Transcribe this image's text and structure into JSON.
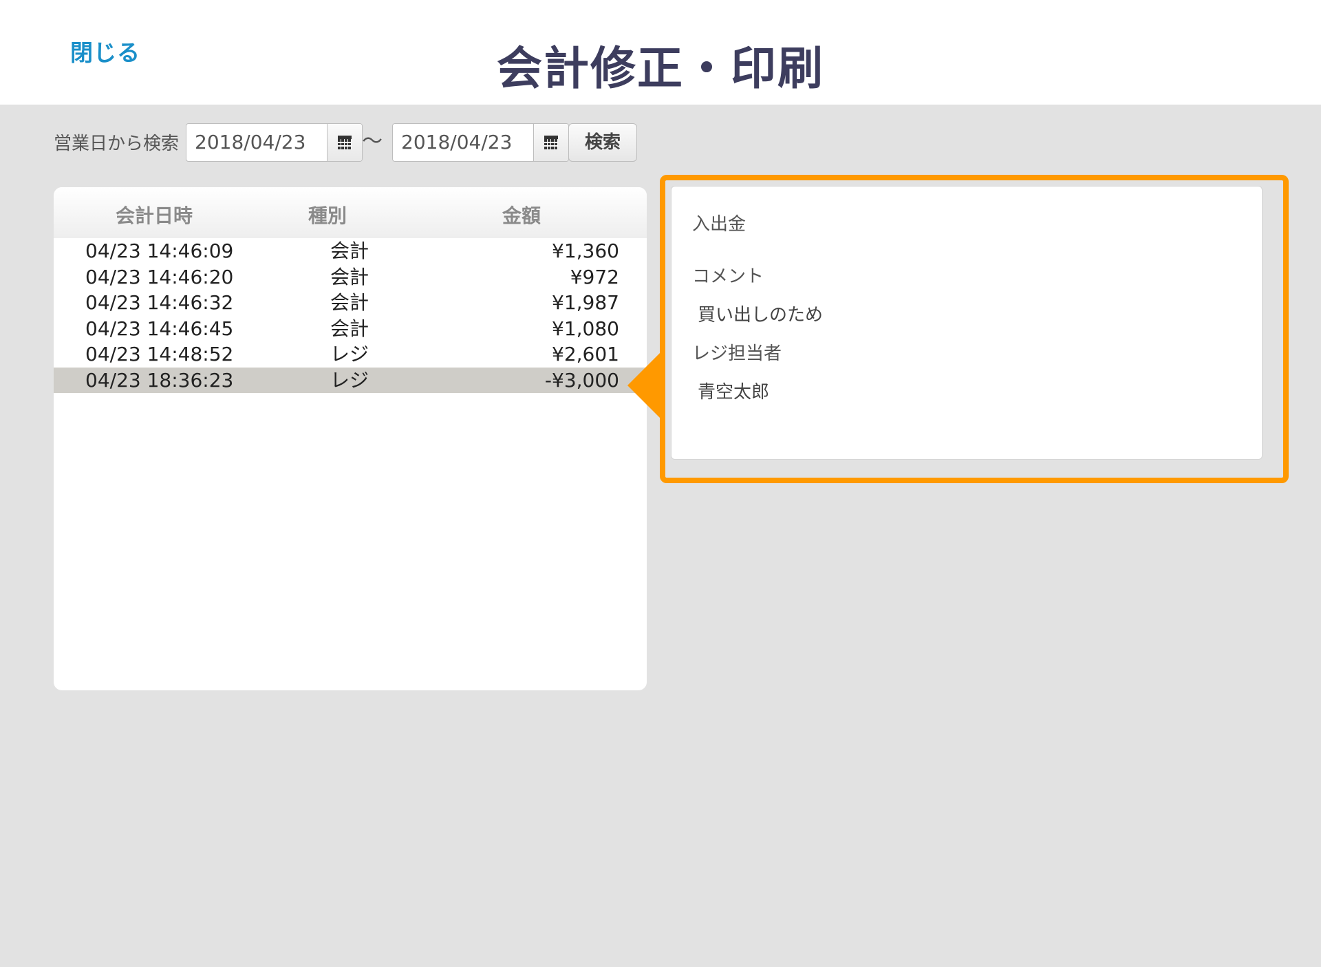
{
  "header": {
    "close_label": "閉じる",
    "title": "会計修正・印刷"
  },
  "search": {
    "label": "営業日から検索",
    "from_date": "2018/04/23",
    "separator": "〜",
    "to_date": "2018/04/23",
    "button_label": "検索"
  },
  "table": {
    "columns": [
      "会計日時",
      "種別",
      "金額"
    ],
    "rows": [
      {
        "datetime": "04/23 14:46:09",
        "type": "会計",
        "amount": "¥1,360",
        "selected": false
      },
      {
        "datetime": "04/23 14:46:20",
        "type": "会計",
        "amount": "¥972",
        "selected": false
      },
      {
        "datetime": "04/23 14:46:32",
        "type": "会計",
        "amount": "¥1,987",
        "selected": false
      },
      {
        "datetime": "04/23 14:46:45",
        "type": "会計",
        "amount": "¥1,080",
        "selected": false
      },
      {
        "datetime": "04/23 14:48:52",
        "type": "レジ",
        "amount": "¥2,601",
        "selected": false
      },
      {
        "datetime": "04/23 18:36:23",
        "type": "レジ",
        "amount": "-¥3,000",
        "selected": true
      }
    ]
  },
  "detail": {
    "type_label": "入出金",
    "comment_label": "コメント",
    "comment_value": "買い出しのため",
    "staff_label": "レジ担当者",
    "staff_value": "青空太郎"
  },
  "colors": {
    "accent": "#ff9900",
    "link": "#1a8fc9",
    "title": "#3d3d5e",
    "selected_row": "#cfcdc8",
    "background": "#e2e2e2"
  },
  "icons": {
    "calendar": "calendar-icon"
  }
}
